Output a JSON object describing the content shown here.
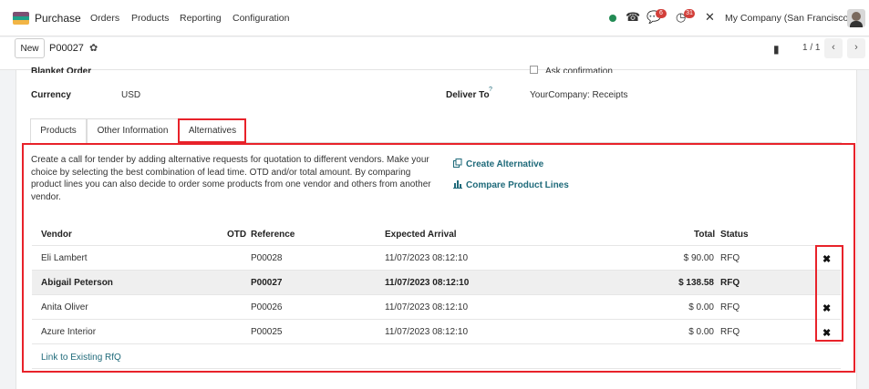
{
  "navbar": {
    "app_name": "Purchase",
    "menu": [
      "Orders",
      "Products",
      "Reporting",
      "Configuration"
    ],
    "phone_icon": "phone-icon",
    "messages_badge": "6",
    "activities_badge": "31",
    "company": "My Company (San Francisco)"
  },
  "control": {
    "new_label": "New",
    "record_name": "P00027",
    "pager": "1 / 1",
    "prev": "‹",
    "next": "›"
  },
  "form": {
    "blanket_order_label": "Blanket Order",
    "ask_confirmation_label": "Ask confirmation",
    "currency_label": "Currency",
    "currency_value": "USD",
    "deliver_to_label": "Deliver To",
    "deliver_to_help": "?",
    "deliver_to_value": "YourCompany: Receipts"
  },
  "tabs": [
    {
      "label": "Products"
    },
    {
      "label": "Other Information"
    },
    {
      "label": "Alternatives"
    }
  ],
  "alternatives": {
    "description": "Create a call for tender by adding alternative requests for quotation to different vendors. Make your choice by selecting the best combination of lead time. OTD and/or total amount. By comparing product lines you can also decide to order some products from one vendor and others from another vendor.",
    "create_alternative": "Create Alternative",
    "compare_lines": "Compare Product Lines",
    "columns": {
      "vendor": "Vendor",
      "otd": "OTD",
      "reference": "Reference",
      "expected_arrival": "Expected Arrival",
      "total": "Total",
      "status": "Status"
    },
    "rows": [
      {
        "vendor": "Eli Lambert",
        "reference": "P00028",
        "arrival": "11/07/2023 08:12:10",
        "total": "$ 90.00",
        "status": "RFQ",
        "delete": "✖"
      },
      {
        "vendor": "Abigail Peterson",
        "reference": "P00027",
        "arrival": "11/07/2023 08:12:10",
        "total": "$ 138.58",
        "status": "RFQ",
        "delete": ""
      },
      {
        "vendor": "Anita Oliver",
        "reference": "P00026",
        "arrival": "11/07/2023 08:12:10",
        "total": "$ 0.00",
        "status": "RFQ",
        "delete": "✖"
      },
      {
        "vendor": "Azure Interior",
        "reference": "P00025",
        "arrival": "11/07/2023 08:12:10",
        "total": "$ 0.00",
        "status": "RFQ",
        "delete": "✖"
      }
    ],
    "link_existing": "Link to Existing RfQ"
  },
  "colors": {
    "highlight": "#e8222a",
    "link": "#1f6a7a",
    "badge": "#d23f3a",
    "online": "#228b54"
  }
}
